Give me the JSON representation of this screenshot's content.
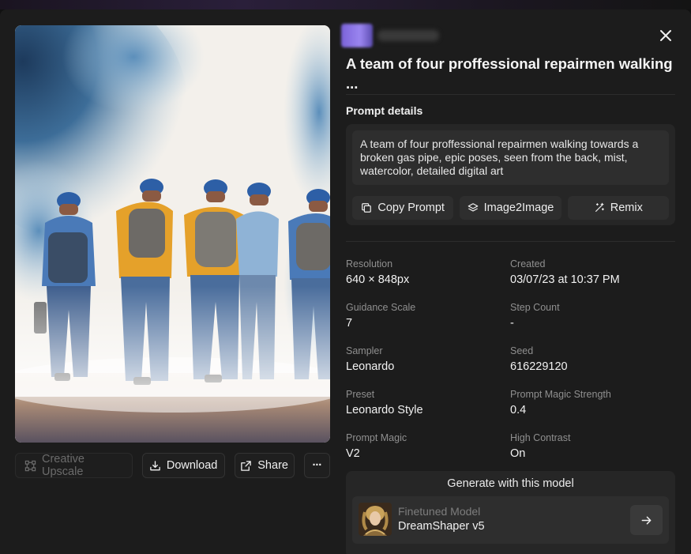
{
  "image": {
    "alt": "Watercolor of four repairmen walking away"
  },
  "image_actions": {
    "upscale_label": "Creative Upscale",
    "download_label": "Download",
    "share_label": "Share",
    "more_label": "···"
  },
  "title": "A team of four proffessional repairmen walking ...",
  "prompt": {
    "section_label": "Prompt details",
    "text": "A team of four proffessional repairmen walking towards a broken gas pipe, epic poses, seen from the back, mist, watercolor, detailed digital art",
    "copy_label": "Copy Prompt",
    "image2image_label": "Image2Image",
    "remix_label": "Remix"
  },
  "meta": [
    {
      "label": "Resolution",
      "value": "640 × 848px"
    },
    {
      "label": "Created",
      "value": "03/07/23 at 10:37 PM"
    },
    {
      "label": "Guidance Scale",
      "value": "7"
    },
    {
      "label": "Step Count",
      "value": "-"
    },
    {
      "label": "Sampler",
      "value": "Leonardo"
    },
    {
      "label": "Seed",
      "value": "616229120"
    },
    {
      "label": "Preset",
      "value": "Leonardo Style"
    },
    {
      "label": "Prompt Magic Strength",
      "value": "0.4"
    },
    {
      "label": "Prompt Magic",
      "value": "V2"
    },
    {
      "label": "High Contrast",
      "value": "On"
    }
  ],
  "model": {
    "card_title": "Generate with this model",
    "kind": "Finetuned Model",
    "name": "DreamShaper v5"
  },
  "colors": {
    "background": "#1c1c1c",
    "card": "#262626",
    "accent_avatar": "#8b74e6"
  }
}
